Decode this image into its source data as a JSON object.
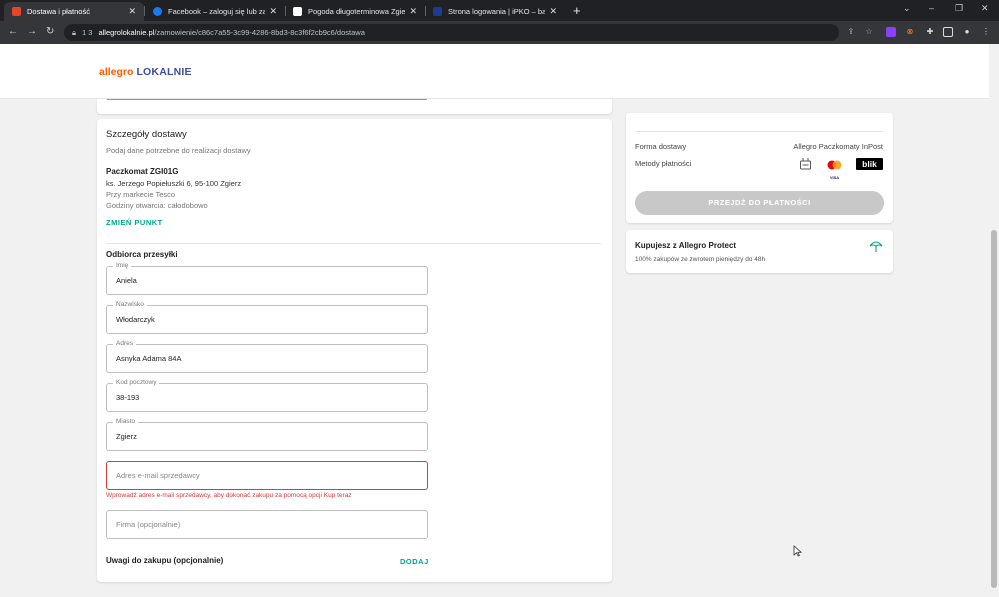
{
  "browser": {
    "tabs": [
      {
        "title": "Dostawa i płatność",
        "fav_color": "#e8442c",
        "active": true
      },
      {
        "title": "Facebook – zaloguj się lub zarejestruj",
        "fav_color": "#1877f2",
        "active": false
      },
      {
        "title": "Pogoda długoterminowa Zgierz",
        "fav_color": "#ffffff",
        "active": false
      },
      {
        "title": "Strona logowania | iPKO – bankowość",
        "fav_color": "#1a3d8f",
        "active": false
      }
    ],
    "close_glyph": "✕",
    "new_tab_glyph": "+",
    "url_prefix": "1 3",
    "url_host": "allegrolokalnie.pl",
    "url_path": "/zamowienie/c86c7a55-3c99-4286-8bd3-8c3f6f2cb9c6/dostawa"
  },
  "header": {
    "logo_part1": "allegro",
    "logo_part2": "LOKALNIE"
  },
  "delivery": {
    "title": "Szczegóły dostawy",
    "subtitle": "Podaj dane potrzebne do realizacji dostawy",
    "point_name": "Paczkomat ZGI01G",
    "point_address": "ks. Jerzego Popiełuszki 6, 95-100 Zgierz",
    "point_location": "Przy markecie Tesco",
    "point_hours": "Godziny otwarcia: całodobowo",
    "change_point": "ZMIEŃ PUNKT"
  },
  "recipient": {
    "title": "Odbiorca przesyłki",
    "fields": [
      {
        "label": "Imię",
        "value": "Aniela"
      },
      {
        "label": "Nazwisko",
        "value": "Włodarczyk"
      },
      {
        "label": "Adres",
        "value": "Asnyka Adama 84A"
      },
      {
        "label": "Kod pocztowy",
        "value": "38-193"
      },
      {
        "label": "Miasto",
        "value": "Zgierz"
      }
    ],
    "email_placeholder": "Adres e-mail sprzedawcy",
    "email_error": "Wprowadź adres e-mail sprzedawcy, aby dokonać zakupu za pomocą opcji Kup teraz",
    "company_placeholder": "Firma (opcjonalnie)",
    "notes_label": "Uwagi do zakupu (opcjonalnie)",
    "notes_add": "DODAJ"
  },
  "summary": {
    "delivery_label": "Forma dostawy",
    "delivery_value": "Allegro Paczkomaty InPost",
    "payment_label": "Metody płatności",
    "blik_label": "blik",
    "visa_label": "VISA",
    "pay_button": "PRZEJDŹ DO PŁATNOŚCI"
  },
  "protect": {
    "title": "Kupujesz z Allegro Protect",
    "subtitle": "100% zakupów ze zwrotem pieniędzy do 48h"
  },
  "colors": {
    "accent": "#00a790",
    "error": "#d93a3a",
    "brand_orange": "#ff5a00"
  }
}
